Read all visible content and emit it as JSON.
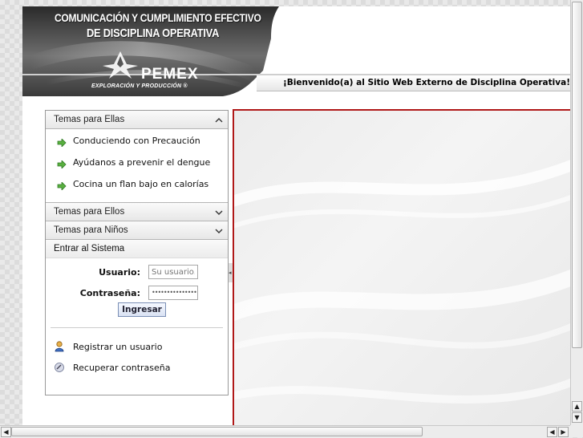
{
  "header": {
    "title_line1": "COMUNICACIÓN Y CUMPLIMIENTO EFECTIVO",
    "title_line2": "DE DISCIPLINA OPERATIVA",
    "logo_word": "PEMEX",
    "logo_sub": "EXPLORACIÓN Y PRODUCCIÓN ®",
    "welcome": "¡Bienvenido(a) al Sitio Web Externo de Disciplina Operativa!"
  },
  "sidebar": {
    "sections": [
      {
        "label": "Temas para Ellas",
        "expanded": true,
        "chevron_icon": "chevron-up-icon",
        "items": [
          {
            "label": "Conduciendo con Precaución",
            "icon": "green-arrow-icon"
          },
          {
            "label": "Ayúdanos a prevenir el dengue",
            "icon": "green-arrow-icon"
          },
          {
            "label": "Cocina un flan bajo en calorías",
            "icon": "green-arrow-icon"
          }
        ]
      },
      {
        "label": "Temas para Ellos",
        "expanded": false,
        "chevron_icon": "chevron-down-icon"
      },
      {
        "label": "Temas para Niños",
        "expanded": false,
        "chevron_icon": "chevron-down-icon"
      }
    ],
    "login": {
      "heading": "Entrar al Sistema",
      "user_label": "Usuario:",
      "user_placeholder": "Su usuario...",
      "password_label": "Contraseña:",
      "password_value": "••••••••••••••••",
      "submit_label": "Ingresar",
      "register_label": "Registrar un usuario",
      "recover_label": "Recuperar contraseña"
    }
  },
  "colors": {
    "content_border": "#b01818",
    "arrow_green": "#4caf3a"
  }
}
